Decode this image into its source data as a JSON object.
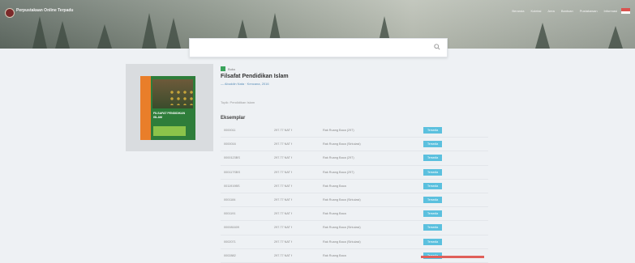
{
  "header": {
    "brand": "Perpustakaan Online Terpadu",
    "nav": [
      "Beranda",
      "Koleksi",
      "Area",
      "Bantuan",
      "Pustakawan",
      "Informasi"
    ]
  },
  "search": {
    "placeholder": ""
  },
  "book": {
    "badge": "Buku",
    "title": "Filsafat Pendidikan Islam",
    "author_line": "— Abuddin Nata · Kencana, 2016",
    "subject_line": "Topik: Pendidikan Islam",
    "cover_title": "FILSAFAT PENDIDIKAN ISLAM"
  },
  "copies_section": {
    "title": "Eksemplar",
    "rows": [
      {
        "code": "0000011",
        "loc": "297.77 NAT f",
        "place": "Rak Ruang Baca (297)",
        "status": "Tersedia"
      },
      {
        "code": "0000016",
        "loc": "297.77 NAT f",
        "place": "Rak Ruang Baca (Sirkulasi)",
        "status": "Tersedia"
      },
      {
        "code": "0000123BS",
        "loc": "297.77 NAT f",
        "place": "Rak Ruang Baca (297)",
        "status": "Tersedia"
      },
      {
        "code": "000117SBS",
        "loc": "297.77 NAT f",
        "place": "Rak Ruang Baca (297)",
        "status": "Tersedia"
      },
      {
        "code": "0011919BS",
        "loc": "297.77 NAT f",
        "place": "Rak Ruang Baca",
        "status": "Tersedia"
      },
      {
        "code": "0001184",
        "loc": "297.77 NAT f",
        "place": "Rak Ruang Baca (Sirkulasi)",
        "status": "Tersedia"
      },
      {
        "code": "0001191",
        "loc": "297.77 NAT f",
        "place": "Rak Ruang Baca",
        "status": "Tersedia"
      },
      {
        "code": "000081609",
        "loc": "297.77 NAT f",
        "place": "Rak Ruang Baca (Sirkulasi)",
        "status": "Tersedia"
      },
      {
        "code": "0002071",
        "loc": "297.77 NAT f",
        "place": "Rak Ruang Baca (Sirkulasi)",
        "status": "Tersedia"
      },
      {
        "code": "0002882",
        "loc": "297.77 NAT f",
        "place": "Rak Ruang Baca",
        "status": "Tersedia"
      }
    ]
  },
  "colors": {
    "status": "#5bc0de",
    "accent": "#e0605a",
    "tag": "#3aa35b"
  }
}
